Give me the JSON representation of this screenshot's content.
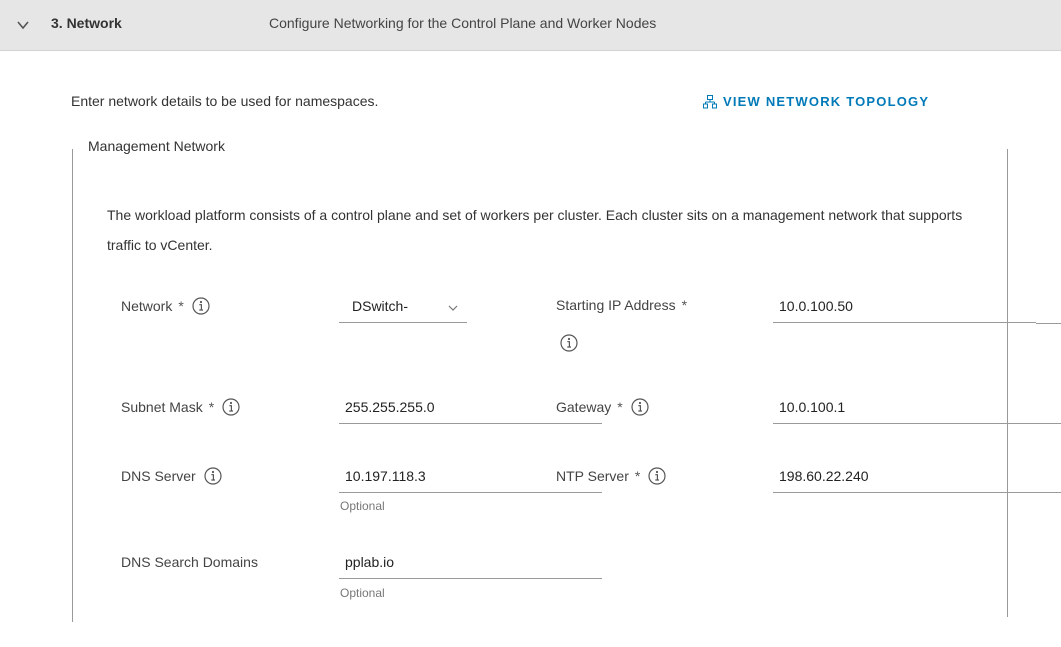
{
  "header": {
    "step_title": "3. Network",
    "step_description": "Configure Networking for the Control Plane and Worker Nodes"
  },
  "intro_text": "Enter network details to be used for namespaces.",
  "topology_link": {
    "label": "VIEW NETWORK TOPOLOGY",
    "icon": "topology-icon"
  },
  "management_network": {
    "legend": "Management Network",
    "description": "The workload platform consists of a control plane and set of workers per cluster. Each cluster sits on a management network that supports traffic to vCenter.",
    "fields": {
      "network": {
        "label": "Network",
        "required": "*",
        "selected": "DSwitch-"
      },
      "starting_ip": {
        "label": "Starting IP Address",
        "required": "*",
        "value": "10.0.100.50"
      },
      "subnet_mask": {
        "label": "Subnet Mask",
        "required": "*",
        "value": "255.255.255.0"
      },
      "gateway": {
        "label": "Gateway",
        "required": "*",
        "value": "10.0.100.1"
      },
      "dns_server": {
        "label": "DNS Server",
        "value": "10.197.118.3",
        "helper": "Optional"
      },
      "ntp_server": {
        "label": "NTP Server",
        "required": "*",
        "value": "198.60.22.240"
      },
      "dns_search_domains": {
        "label": "DNS Search Domains",
        "value": "pplab.io",
        "helper": "Optional"
      }
    }
  },
  "colors": {
    "accent": "#0079b8",
    "header_bg": "#e6e6e6"
  }
}
